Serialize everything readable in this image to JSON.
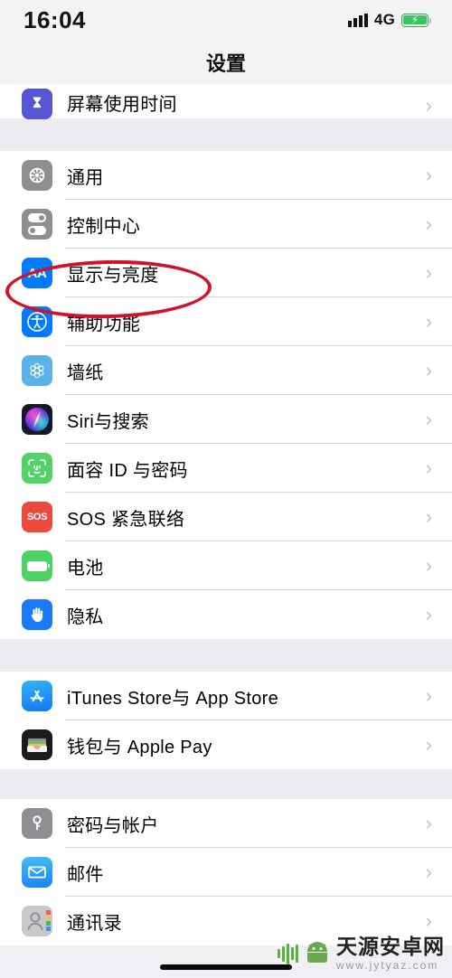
{
  "status_bar": {
    "time": "16:04",
    "network": "4G",
    "signal_icon": "signal-bars-icon",
    "battery_icon": "battery-charging-icon",
    "battery_bolt": "⚡"
  },
  "nav": {
    "title": "设置"
  },
  "colors": {
    "annotation": "#d3112a",
    "group_bg": "#ececf0",
    "row_bg": "#ffffff",
    "separator": "#d8d8dc",
    "chevron": "#c2c2c6"
  },
  "chevron": "›",
  "sections": [
    {
      "id": "section-screentime",
      "rows": [
        {
          "id": "screen-time",
          "label": "屏幕使用时间",
          "icon": "hourglass-icon",
          "icon_class": "ic-screentime",
          "clipped": true
        }
      ]
    },
    {
      "id": "section-system",
      "rows": [
        {
          "id": "general",
          "label": "通用",
          "icon": "gear-icon",
          "icon_class": "ic-general"
        },
        {
          "id": "control-center",
          "label": "控制中心",
          "icon": "toggles-icon",
          "icon_class": "ic-control"
        },
        {
          "id": "display",
          "label": "显示与亮度",
          "icon": "aa-text-icon",
          "icon_class": "ic-display",
          "highlighted": true
        },
        {
          "id": "accessibility",
          "label": "辅助功能",
          "icon": "accessibility-icon",
          "icon_class": "ic-access"
        },
        {
          "id": "wallpaper",
          "label": "墙纸",
          "icon": "flower-icon",
          "icon_class": "ic-wallpaper"
        },
        {
          "id": "siri",
          "label": "Siri与搜索",
          "icon": "siri-orb-icon",
          "icon_class": "ic-siri"
        },
        {
          "id": "faceid",
          "label": "面容 ID 与密码",
          "icon": "face-id-icon",
          "icon_class": "ic-faceid"
        },
        {
          "id": "sos",
          "label": "SOS 紧急联络",
          "icon": "sos-icon",
          "icon_class": "ic-sos"
        },
        {
          "id": "battery",
          "label": "电池",
          "icon": "battery-icon",
          "icon_class": "ic-battery"
        },
        {
          "id": "privacy",
          "label": "隐私",
          "icon": "hand-icon",
          "icon_class": "ic-privacy"
        }
      ]
    },
    {
      "id": "section-stores",
      "rows": [
        {
          "id": "itunes-app-store",
          "label": "iTunes Store与 App Store",
          "icon": "app-store-icon",
          "icon_class": "ic-appstore"
        },
        {
          "id": "wallet-apple-pay",
          "label": "钱包与 Apple Pay",
          "icon": "wallet-icon",
          "icon_class": "ic-wallet"
        }
      ]
    },
    {
      "id": "section-accounts",
      "rows": [
        {
          "id": "passwords-accounts",
          "label": "密码与帐户",
          "icon": "key-icon",
          "icon_class": "ic-key"
        },
        {
          "id": "mail",
          "label": "邮件",
          "icon": "envelope-icon",
          "icon_class": "ic-mail"
        },
        {
          "id": "contacts",
          "label": "通讯录",
          "icon": "contacts-icon",
          "icon_class": "ic-contacts"
        }
      ]
    }
  ],
  "annotation": {
    "type": "red-ellipse",
    "targets": "显示与亮度"
  },
  "watermark": {
    "title": "天源安卓网",
    "url": "www.jytyaz.com",
    "logo": "android-robot-icon"
  }
}
